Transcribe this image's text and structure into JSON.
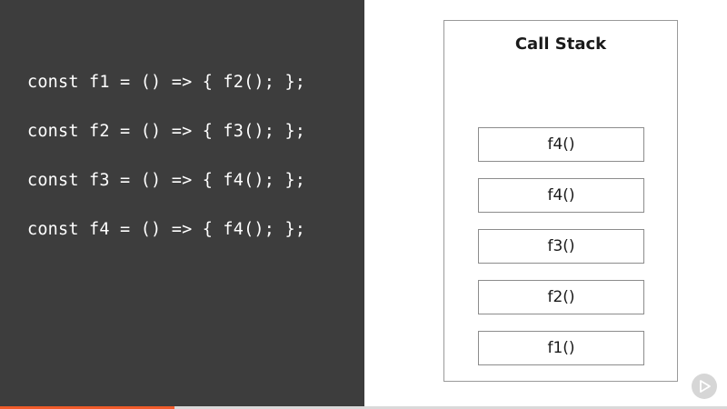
{
  "code": {
    "lines": [
      "const f1 = () => { f2(); };",
      "const f2 = () => { f3(); };",
      "const f3 = () => { f4(); };",
      "const f4 = () => { f4(); };"
    ]
  },
  "call_stack": {
    "title": "Call Stack",
    "frames_top_to_bottom": [
      "f4()",
      "f4()",
      "f3()",
      "f2()",
      "f1()"
    ]
  },
  "video_progress": {
    "fraction": 0.24,
    "fill_color": "#f15b2a"
  },
  "colors": {
    "code_background": "#3d3d3d",
    "code_text": "#ffffff"
  },
  "logo": {
    "icon": "play-logo-icon"
  }
}
